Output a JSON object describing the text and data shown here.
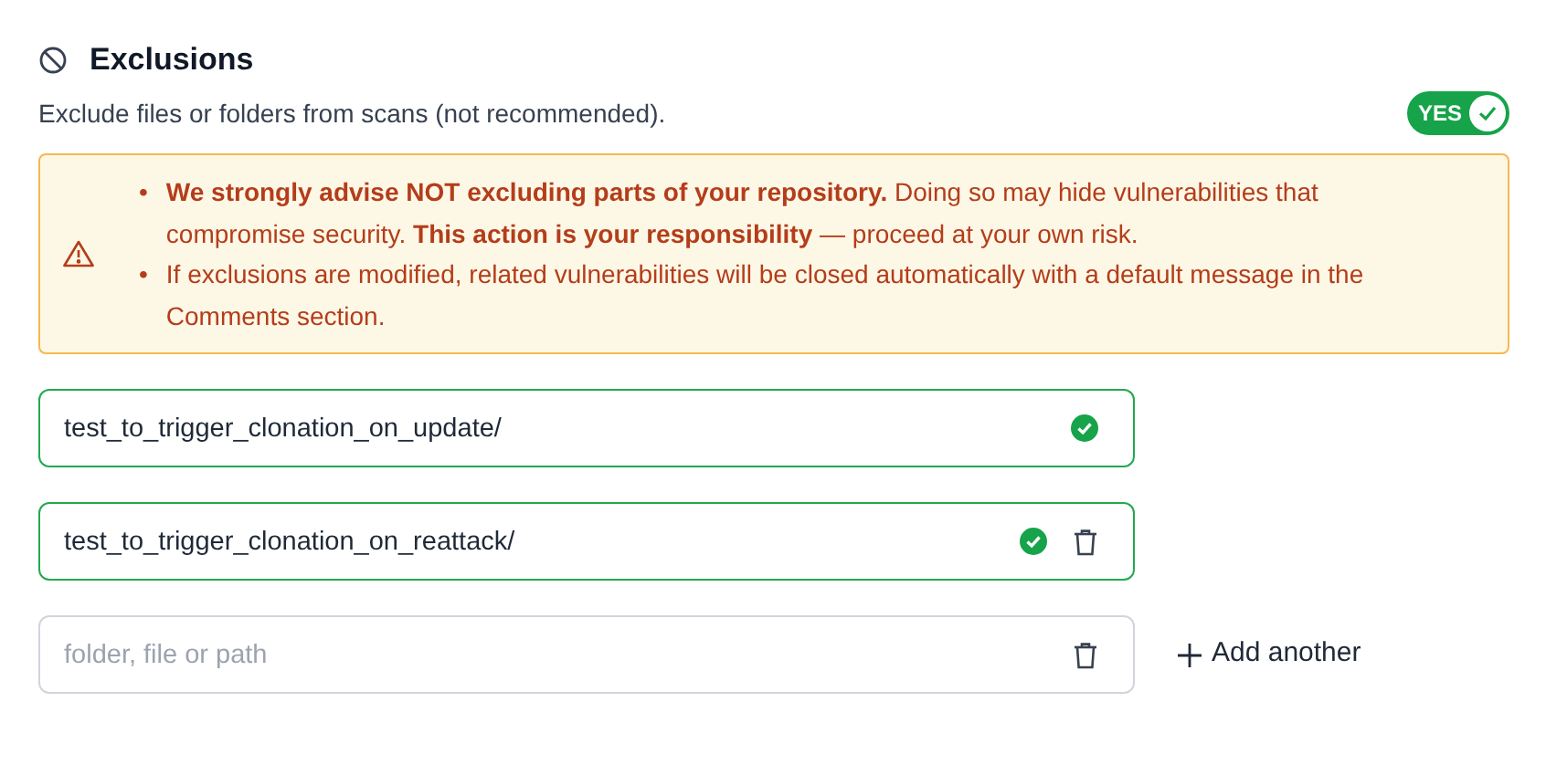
{
  "section": {
    "title": "Exclusions",
    "description": "Exclude files or folders from scans (not recommended).",
    "toggle": {
      "label": "YES",
      "on": true
    }
  },
  "warning": {
    "marker": "•",
    "items": [
      "**We strongly advise NOT excluding parts of your repository.** Doing so may hide vulnerabilities that compromise security. **This action is your responsibility** — proceed at your own risk.",
      "If exclusions are modified, related vulnerabilities will be closed automatically with a default message in the Comments section."
    ]
  },
  "paths": [
    {
      "value": "test_to_trigger_clonation_on_update/",
      "valid": true,
      "deletable": false
    },
    {
      "value": "test_to_trigger_clonation_on_reattack/",
      "valid": true,
      "deletable": true
    },
    {
      "placeholder": "folder, file or path",
      "valid": false,
      "deletable": true
    }
  ],
  "add_button": {
    "label": "Add another"
  }
}
